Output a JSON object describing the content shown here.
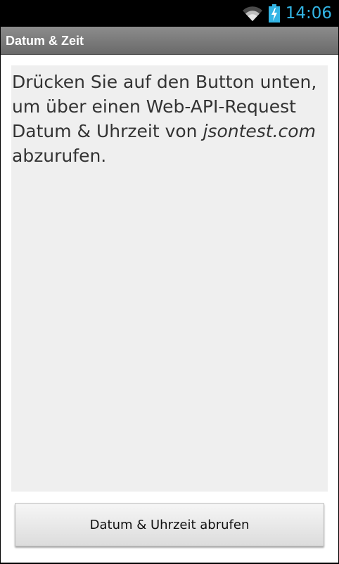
{
  "status_bar": {
    "time": "14:06",
    "wifi_icon": "wifi-icon",
    "battery_icon": "battery-charging-icon",
    "accent_color": "#33b5e5"
  },
  "title_bar": {
    "title": "Datum & Zeit"
  },
  "content": {
    "text_part1": "Drücken Sie auf den Button unten, um über einen Web-API-Request Datum & Uhrzeit von ",
    "text_italic": "jsontest.com",
    "text_part2": " abzurufen."
  },
  "button": {
    "label": "Datum & Uhrzeit abrufen"
  }
}
